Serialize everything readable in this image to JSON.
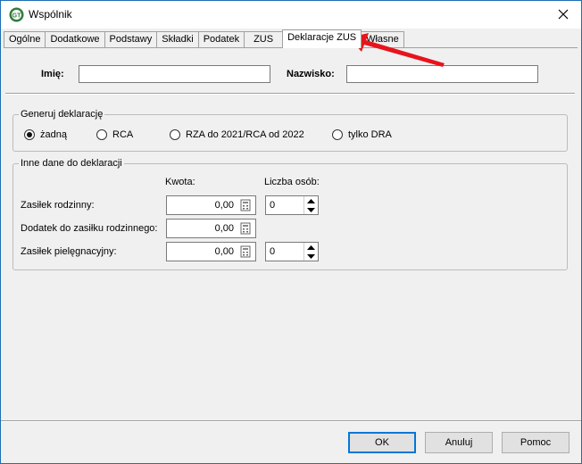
{
  "window": {
    "title": "Wspólnik",
    "app_icon": "app-logo-icon",
    "close_icon": "close-icon"
  },
  "tabs": [
    {
      "label": "Ogólne"
    },
    {
      "label": "Dodatkowe"
    },
    {
      "label": "Podstawy"
    },
    {
      "label": "Składki"
    },
    {
      "label": "Podatek"
    },
    {
      "label": "ZUS"
    },
    {
      "label": "Deklaracje ZUS",
      "active": true
    },
    {
      "label": "Własne"
    }
  ],
  "name_row": {
    "first_name_label": "Imię:",
    "first_name_value": "",
    "last_name_label": "Nazwisko:",
    "last_name_value": ""
  },
  "generate_group": {
    "legend": "Generuj deklarację",
    "options": [
      {
        "label": "żadną",
        "selected": true
      },
      {
        "label": "RCA",
        "selected": false
      },
      {
        "label": "RZA do 2021/RCA od 2022",
        "selected": false
      },
      {
        "label": "tylko DRA",
        "selected": false
      }
    ]
  },
  "other_group": {
    "legend": "Inne dane do deklaracji",
    "amount_header": "Kwota:",
    "persons_header": "Liczba osób:",
    "rows": [
      {
        "label": "Zasiłek rodzinny:",
        "amount": "0,00",
        "persons": "0",
        "has_persons": true
      },
      {
        "label": "Dodatek do zasiłku rodzinnego:",
        "amount": "0,00",
        "has_persons": false
      },
      {
        "label": "Zasiłek pielęgnacyjny:",
        "amount": "0,00",
        "persons": "0",
        "has_persons": true
      }
    ]
  },
  "buttons": {
    "ok": "OK",
    "cancel": "Anuluj",
    "help": "Pomoc"
  },
  "annotation": {
    "arrow_color": "#e8141b"
  }
}
